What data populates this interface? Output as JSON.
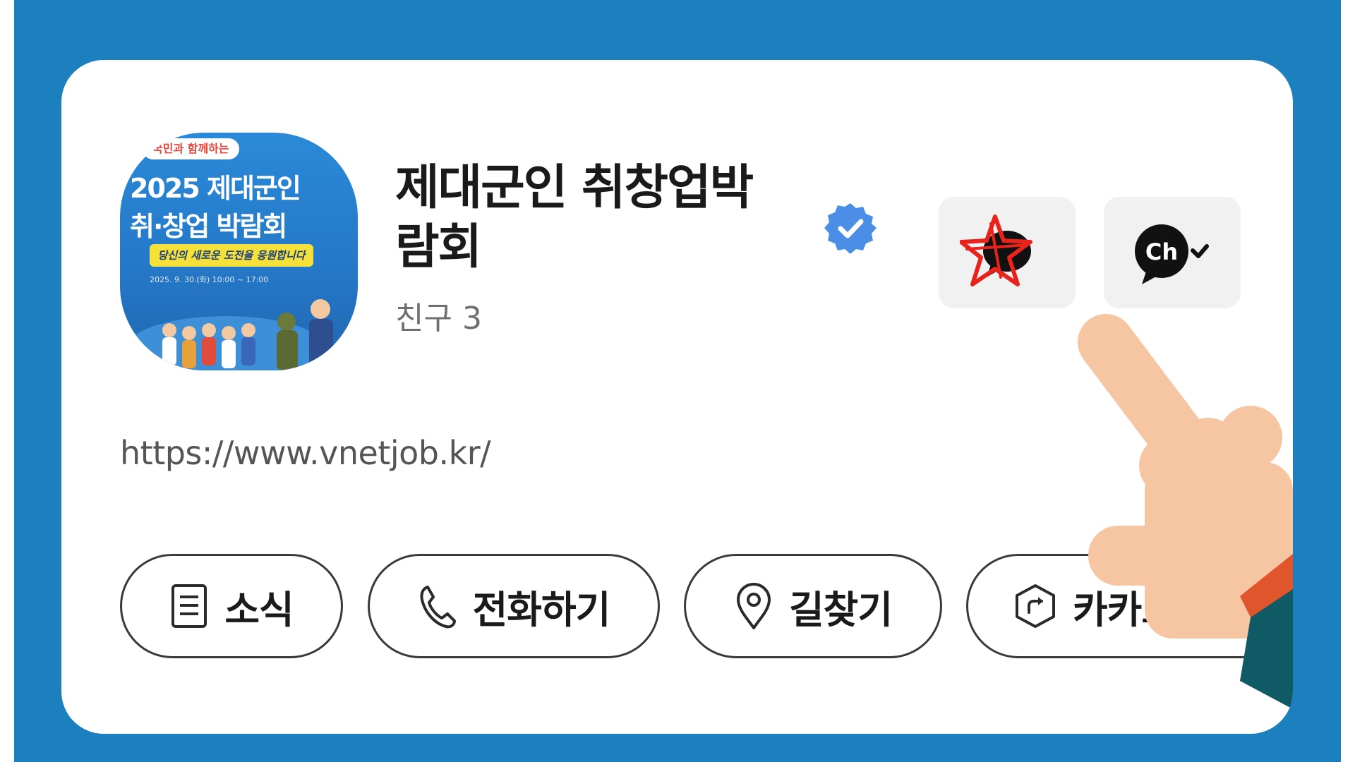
{
  "profile": {
    "name": "제대군인 취창업박람회",
    "name_line1": "제대군인 취창업박",
    "name_line2": "람회",
    "friends": "친구 3",
    "url": "https://www.vnetjob.kr/",
    "verified": true
  },
  "avatar": {
    "ribbon": "국민과 함께하는",
    "line1": "2025 제대군인",
    "line2": "취·창업 박람회",
    "slogan": "당신의 새로운 도전을 응원합니다",
    "date": "2025. 9. 30.(화) 10:00 ~ 17:00"
  },
  "actions": [
    {
      "label": "소식",
      "icon": "document-icon"
    },
    {
      "label": "전화하기",
      "icon": "phone-icon"
    },
    {
      "label": "길찾기",
      "icon": "map-pin-icon"
    },
    {
      "label": "카카오내비",
      "icon": "navigation-icon"
    }
  ],
  "header_buttons": {
    "chat_icon": "chat-bubble-icon",
    "channel_icon": "channel-add-icon",
    "channel_text": "Ch"
  },
  "colors": {
    "background": "#1c80bf",
    "card": "#ffffff",
    "verified": "#4a8ee8",
    "annotation_star": "#e8231c",
    "hand_skin": "#f6c6a2",
    "sleeve_orange": "#e0552c",
    "sleeve_teal": "#0f5a64"
  }
}
